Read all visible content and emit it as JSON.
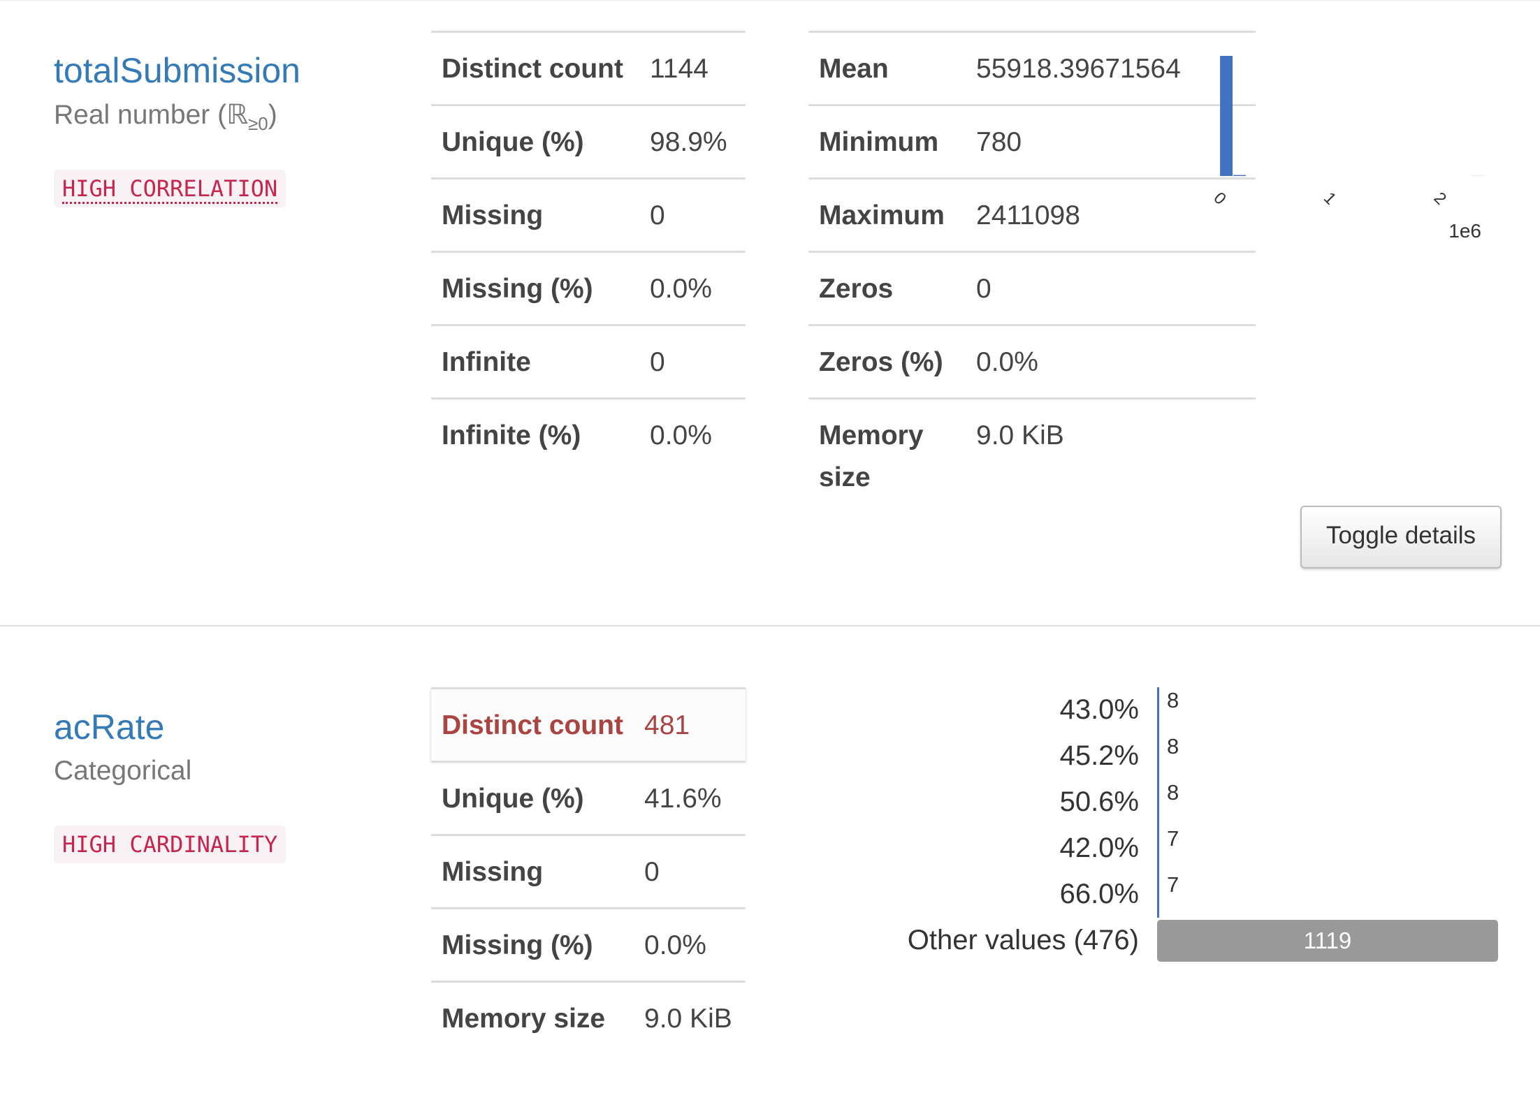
{
  "variables": [
    {
      "name": "totalSubmission",
      "type_text": "Real number (ℝ",
      "type_sub": "≥0",
      "type_close": ")",
      "badge": "HIGH CORRELATION",
      "stats_left": [
        {
          "label": "Distinct count",
          "value": "1144"
        },
        {
          "label": "Unique (%)",
          "value": "98.9%"
        },
        {
          "label": "Missing",
          "value": "0"
        },
        {
          "label": "Missing (%)",
          "value": "0.0%"
        },
        {
          "label": "Infinite",
          "value": "0"
        },
        {
          "label": "Infinite (%)",
          "value": "0.0%"
        }
      ],
      "stats_right": [
        {
          "label": "Mean",
          "value": "55918.39671564"
        },
        {
          "label": "Minimum",
          "value": "780"
        },
        {
          "label": "Maximum",
          "value": "2411098"
        },
        {
          "label": "Zeros",
          "value": "0"
        },
        {
          "label": "Zeros (%)",
          "value": "0.0%"
        },
        {
          "label": "Memory size",
          "value": "9.0 KiB"
        }
      ],
      "histogram": {
        "type": "bar",
        "xlim": [
          0,
          2411098
        ],
        "x_tick_labels": [
          "0",
          "1",
          "2"
        ],
        "x_scale_label": "1e6",
        "bins": [
          {
            "x0": 780,
            "x1": 120796,
            "count": 1127
          },
          {
            "x0": 120796,
            "x1": 240812,
            "count": 9
          },
          {
            "x0": 240812,
            "x1": 360828,
            "count": 0
          },
          {
            "x0": 360828,
            "x1": 480844,
            "count": 0
          },
          {
            "x0": 480844,
            "x1": 600860,
            "count": 0
          },
          {
            "x0": 600860,
            "x1": 720876,
            "count": 0
          },
          {
            "x0": 720876,
            "x1": 840892,
            "count": 0
          },
          {
            "x0": 840892,
            "x1": 960908,
            "count": 0
          },
          {
            "x0": 960908,
            "x1": 1080924,
            "count": 0
          },
          {
            "x0": 1080924,
            "x1": 1200940,
            "count": 0
          },
          {
            "x0": 1200940,
            "x1": 1320956,
            "count": 0
          },
          {
            "x0": 1320956,
            "x1": 1440972,
            "count": 0
          },
          {
            "x0": 1440972,
            "x1": 1560988,
            "count": 0
          },
          {
            "x0": 1560988,
            "x1": 1681004,
            "count": 0
          },
          {
            "x0": 1681004,
            "x1": 1801020,
            "count": 0
          },
          {
            "x0": 1801020,
            "x1": 1921036,
            "count": 0
          },
          {
            "x0": 1921036,
            "x1": 2041052,
            "count": 0
          },
          {
            "x0": 2041052,
            "x1": 2161068,
            "count": 0
          },
          {
            "x0": 2161068,
            "x1": 2281084,
            "count": 0
          },
          {
            "x0": 2281084,
            "x1": 2411098,
            "count": 1
          }
        ],
        "color": "#4271c1"
      },
      "toggle_label": "Toggle details"
    },
    {
      "name": "acRate",
      "type_text": "Categorical",
      "badge": "HIGH CARDINALITY",
      "stats_left": [
        {
          "label": "Distinct count",
          "value": "481"
        },
        {
          "label": "Unique (%)",
          "value": "41.6%"
        },
        {
          "label": "Missing",
          "value": "0"
        },
        {
          "label": "Missing (%)",
          "value": "0.0%"
        },
        {
          "label": "Memory size",
          "value": "9.0 KiB"
        }
      ],
      "frequencies": {
        "type": "bar",
        "max_count": 1119,
        "items": [
          {
            "label": "43.0%",
            "count": 8
          },
          {
            "label": "45.2%",
            "count": 8
          },
          {
            "label": "50.6%",
            "count": 8
          },
          {
            "label": "42.0%",
            "count": 7
          },
          {
            "label": "66.0%",
            "count": 7
          },
          {
            "label": "Other values (476)",
            "count": 1119
          }
        ],
        "bar_color": "#4271c1",
        "other_color": "#999999"
      }
    }
  ]
}
